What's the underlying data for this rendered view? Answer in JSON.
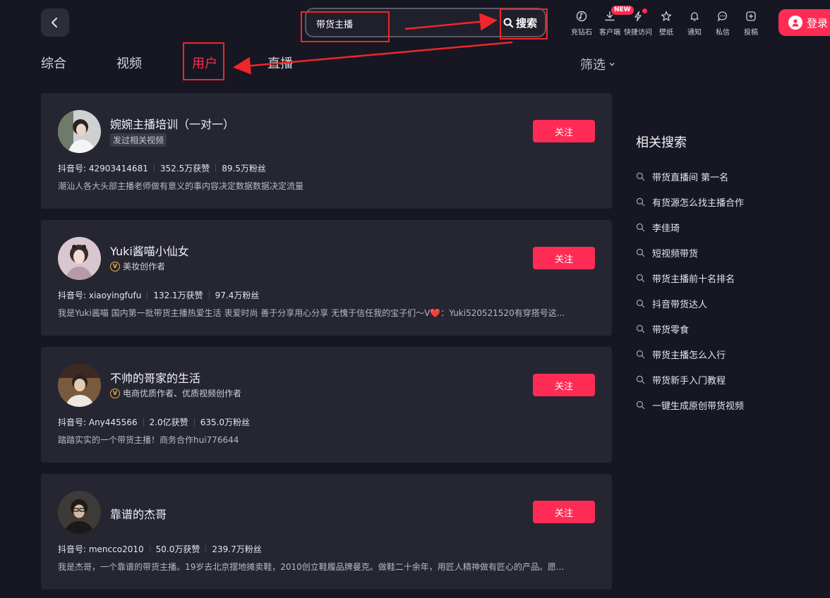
{
  "header": {
    "search": {
      "value": "带货主播",
      "button_label": "搜索"
    },
    "toolbar": [
      {
        "icon": "diamond-icon",
        "label": "充钻石"
      },
      {
        "icon": "download-icon",
        "label": "客户端",
        "badge": "NEW"
      },
      {
        "icon": "lightning-icon",
        "label": "快捷访问"
      },
      {
        "icon": "wallpaper-icon",
        "label": "壁纸"
      },
      {
        "icon": "bell-icon",
        "label": "通知"
      },
      {
        "icon": "message-icon",
        "label": "私信"
      },
      {
        "icon": "upload-icon",
        "label": "投稿"
      }
    ],
    "login_label": "登录"
  },
  "tabs": [
    {
      "label": "综合",
      "active": false
    },
    {
      "label": "视频",
      "active": false
    },
    {
      "label": "用户",
      "active": true
    },
    {
      "label": "直播",
      "active": false
    }
  ],
  "filter_label": "筛选",
  "users": [
    {
      "name": "婉婉主播培训（一对一）",
      "tag": "发过相关视频",
      "id_label": "抖音号: 42903414681",
      "likes": "352.5万获赞",
      "fans": "89.5万粉丝",
      "bio": "潮汕人各大头部主播老师做有意义的事内容决定数据数据决定流量",
      "follow_label": "关注"
    },
    {
      "name": "Yuki酱喵小仙女",
      "verified": "美妆创作者",
      "id_label": "抖音号: xiaoyingfufu",
      "likes": "132.1万获赞",
      "fans": "97.4万粉丝",
      "bio": "我是Yuki酱喵 国内第一批带货主播热爱生活 衷爱时尚 善于分享用心分享 无愧于信任我的宝子们～V❤️：Yuki520521520有穿搭号这...",
      "follow_label": "关注"
    },
    {
      "name": "不帅的哥家的生活",
      "verified": "电商优质作者、优质视频创作者",
      "id_label": "抖音号: Any445566",
      "likes": "2.0亿获赞",
      "fans": "635.0万粉丝",
      "bio": "踏踏实实的一个带货主播！商务合作hui776644",
      "follow_label": "关注"
    },
    {
      "name": "靠谱的杰哥",
      "id_label": "抖音号: mencco2010",
      "likes": "50.0万获赞",
      "fans": "239.7万粉丝",
      "bio": "我是杰哥，一个靠谱的带货主播。19岁去北京摆地摊卖鞋，2010创立鞋履品牌曼克。做鞋二十余年，用匠人精神做有匠心的产品。愿...",
      "follow_label": "关注"
    }
  ],
  "related": {
    "title": "相关搜索",
    "items": [
      "带货直播间 第一名",
      "有货源怎么找主播合作",
      "李佳琦",
      "短视频带货",
      "带货主播前十名排名",
      "抖音带货达人",
      "带货零食",
      "带货主播怎么入行",
      "带货新手入门教程",
      "一键生成原创带货视频"
    ]
  },
  "colors": {
    "accent": "#fe2c55",
    "background": "#161722",
    "card": "#252632",
    "annotation": "#f0262a"
  }
}
